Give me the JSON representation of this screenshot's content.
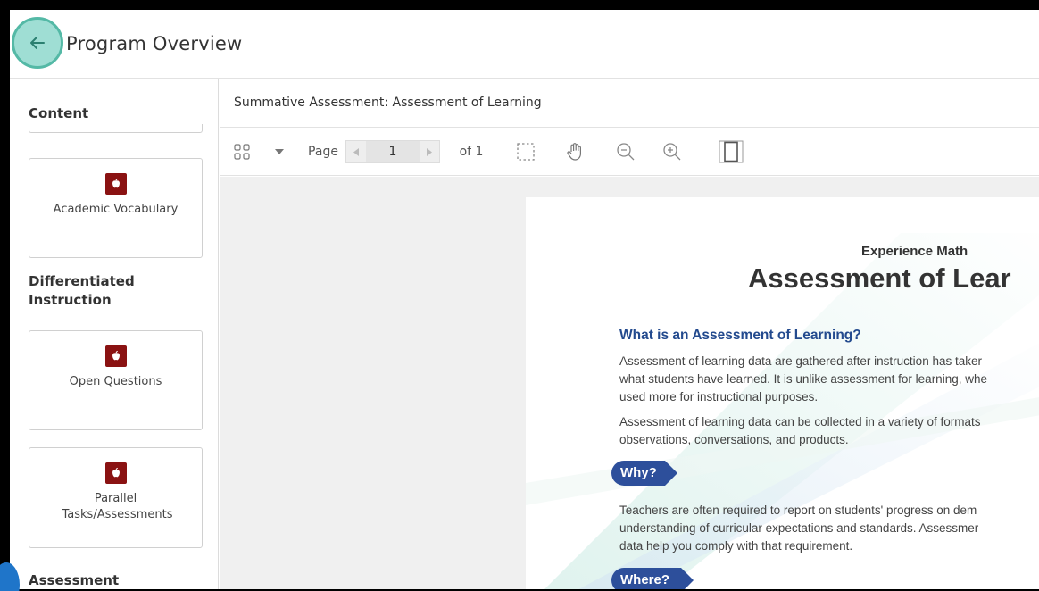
{
  "header": {
    "title": "Program Overview",
    "back_icon": "arrow-left-icon"
  },
  "sidebar": {
    "section_content": "Content",
    "section_differentiated": "Differentiated Instruction",
    "section_assessment": "Assessment",
    "cards": [
      {
        "label": "Academic Vocabulary",
        "icon": "apple-icon"
      },
      {
        "label": "Open Questions",
        "icon": "apple-icon"
      },
      {
        "label": "Parallel Tasks/Assessments",
        "icon": "apple-icon"
      }
    ]
  },
  "document": {
    "title": "Summative Assessment: Assessment of Learning",
    "toolbar": {
      "page_label": "Page",
      "current_page": "1",
      "of_label": "of 1"
    },
    "pdf": {
      "kicker": "Experience Math",
      "headline": "Assessment of Lear",
      "question": "What is an Assessment of Learning?",
      "para1": [
        "Assessment of learning data are gathered after instruction has taker",
        "what students have learned. It is unlike assessment for learning, whe",
        "used more for instructional purposes."
      ],
      "para2": [
        "Assessment of learning data can be collected in a variety of formats",
        "observations, conversations, and products."
      ],
      "tag_why": "Why?",
      "para3": [
        "Teachers are often required to report on students' progress on dem",
        "understanding of curricular expectations and standards. Assessmer",
        "data help you comply with that requirement."
      ],
      "tag_where": "Where?"
    }
  },
  "colors": {
    "accent_teal": "#54b9a6",
    "icon_red": "#8a1212",
    "heading_blue": "#234a8e",
    "tag_blue": "#2d4f9b"
  }
}
